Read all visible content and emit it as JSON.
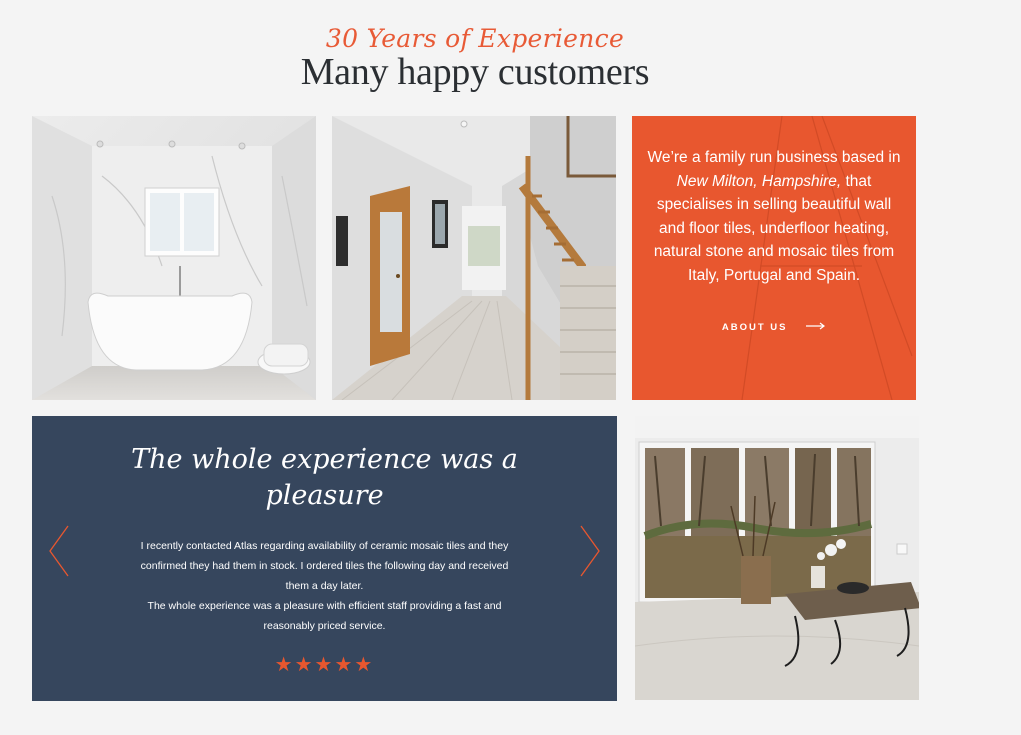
{
  "section": {
    "eyebrow": "30 Years of Experience",
    "heading": "Many happy customers"
  },
  "info": {
    "text_before": "We’re a family run business based in ",
    "location": "New Milton, Hampshire,",
    "text_after": " that specialises in selling beautiful wall and floor tiles, underfloor heating, natural stone and mosaic tiles from Italy, Portugal and Spain.",
    "link_label": "ABOUT US",
    "accent_color": "#e8572f"
  },
  "testimonial": {
    "title": "The whole experience was a pleasure",
    "paragraph_1": "I recently contacted Atlas regarding availability of ceramic mosaic tiles and they confirmed they had them in stock. I ordered tiles the following day and received them a day later.",
    "paragraph_2": "The whole experience was a pleasure with efficient staff providing a fast and reasonably priced service.",
    "stars": "★★★★★",
    "rating": 5,
    "rating_max": 5,
    "background_color": "#36465d"
  },
  "icons": {
    "prev": "chevron-left-icon",
    "next": "chevron-right-icon",
    "about_arrow": "arrow-right-icon"
  }
}
